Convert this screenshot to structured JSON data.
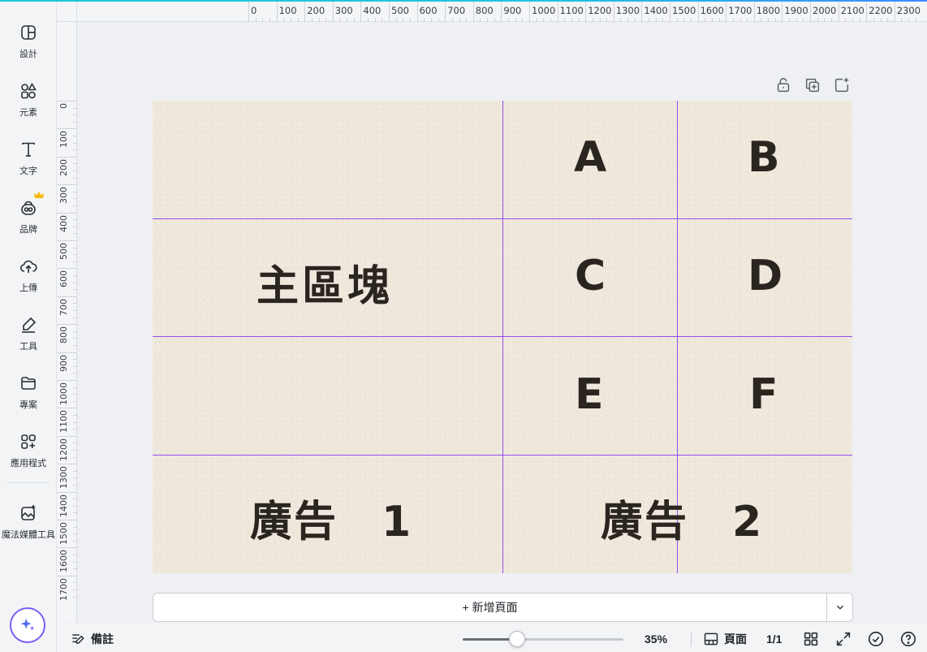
{
  "sidebar": {
    "items": [
      {
        "label": "設計",
        "icon": "layout-icon"
      },
      {
        "label": "元素",
        "icon": "shapes-icon"
      },
      {
        "label": "文字",
        "icon": "text-icon"
      },
      {
        "label": "品牌",
        "icon": "brand-icon"
      },
      {
        "label": "上傳",
        "icon": "cloud-upload-icon"
      },
      {
        "label": "工具",
        "icon": "pen-tool-icon"
      },
      {
        "label": "專案",
        "icon": "folder-icon"
      },
      {
        "label": "應用程式",
        "icon": "apps-icon"
      },
      {
        "label": "魔法媒體工具",
        "icon": "magic-media-icon"
      }
    ]
  },
  "ruler": {
    "top": [
      "0",
      "100",
      "200",
      "300",
      "400",
      "500",
      "600",
      "700",
      "800",
      "900",
      "1000",
      "1100",
      "1200",
      "1300",
      "1400",
      "1500",
      "1600",
      "1700",
      "1800",
      "1900",
      "2000",
      "2100",
      "2200",
      "2300"
    ],
    "left": [
      "0",
      "100",
      "200",
      "300",
      "400",
      "500",
      "600",
      "700",
      "800",
      "900",
      "1000",
      "1100",
      "1200",
      "1300",
      "1400",
      "1500",
      "1600",
      "1700"
    ]
  },
  "canvas": {
    "main_block": "主區塊",
    "cells": [
      "A",
      "B",
      "C",
      "D",
      "E",
      "F"
    ],
    "ad1": "廣告　1",
    "ad2": "廣告　2",
    "guide_color": "#8b3ff0",
    "background_color": "#efe8dd"
  },
  "add_page": {
    "label": "+ 新增頁面"
  },
  "bottom": {
    "notes_label": "備註",
    "zoom_label": "35%",
    "zoom_fraction": 0.34,
    "pages_label": "頁面",
    "page_count": "1/1"
  },
  "colors": {
    "accent": "#7d5cf5",
    "top_gradient": "#1ec8d6"
  }
}
